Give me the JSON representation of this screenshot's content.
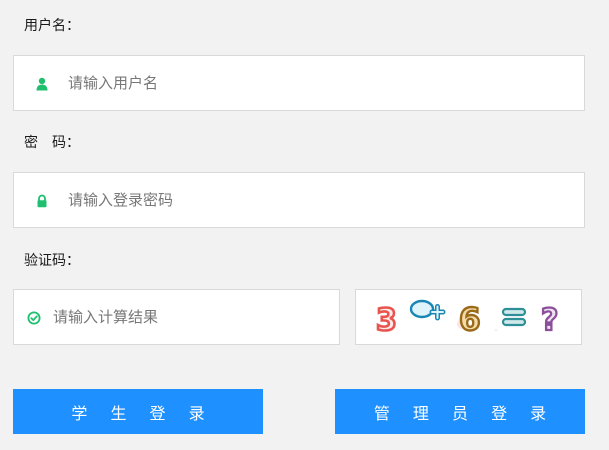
{
  "form": {
    "username": {
      "label": "用户名：",
      "placeholder": "请输入用户名",
      "icon": "user-icon",
      "icon_color": "#1fbf6f"
    },
    "password": {
      "label": "密　码：",
      "placeholder": "请输入登录密码",
      "icon": "lock-icon",
      "icon_color": "#1fbf6f"
    },
    "captcha": {
      "label": "验证码：",
      "placeholder": "请输入计算结果",
      "icon": "check-circle-icon",
      "icon_color": "#1fbf6f",
      "image_text": "3+6=?"
    }
  },
  "buttons": {
    "student_login": "学 生 登 录",
    "admin_login": "管 理 员 登 录",
    "color": "#1e90ff"
  }
}
